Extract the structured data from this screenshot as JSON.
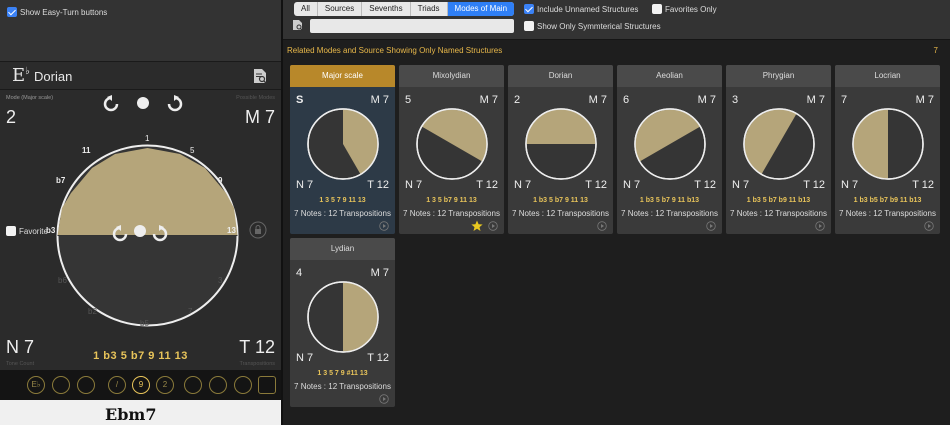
{
  "left": {
    "easy_turn_label": "Show Easy-Turn buttons",
    "key_letter": "E",
    "key_accidental": "♭",
    "mode_name": "Dorian",
    "mode_source_label": "Mode (Major scale)",
    "possible_modes_label": "Possible Modes",
    "mode_number": "2",
    "mode_count": "M 7",
    "favorite_label": "Favorite",
    "note_count": "N 7",
    "transpositions": "T 12",
    "tone_count_label": "Tone Count",
    "transpositions_label": "Transpositions",
    "formula": "1 b3 5 b7 9 11 13",
    "dial_labels": [
      "1",
      "5",
      "9",
      "13",
      "3",
      "7",
      "b5",
      "b2",
      "b6",
      "b3",
      "b7",
      "11"
    ],
    "toolbar_buttons": [
      "E♭",
      "",
      "",
      "",
      "/",
      "9",
      "2",
      "",
      "",
      "",
      ""
    ],
    "chord_name": "Ebm7",
    "accent_color": "#b5a57a"
  },
  "filter": {
    "tabs": [
      "All",
      "Sources",
      "Sevenths",
      "Triads",
      "Modes of Main"
    ],
    "active_tab": "Modes of Main",
    "include_unnamed_label": "Include Unnamed Structures",
    "favorites_only_label": "Favorites Only",
    "symmetrical_label": "Show Only Symmterical Structures",
    "search_value": ""
  },
  "related": {
    "title": "Related Modes and Source Showing Only Named Structures",
    "count": "7"
  },
  "cards": [
    {
      "name": "Major scale",
      "tl": "S",
      "tr": "M 7",
      "bl": "N 7",
      "br": "T 12",
      "formula": "1 3 5 7 9 11 13",
      "notes": "7 Notes : 12 Transpositions",
      "selected": true,
      "start": 0,
      "end": 150,
      "favorite": false
    },
    {
      "name": "Mixolydian",
      "tl": "5",
      "tr": "M 7",
      "bl": "N 7",
      "br": "T 12",
      "formula": "1 3 5 b7 9 11 13",
      "notes": "7 Notes : 12 Transpositions",
      "selected": false,
      "start": -60,
      "end": 120,
      "favorite": true
    },
    {
      "name": "Dorian",
      "tl": "2",
      "tr": "M 7",
      "bl": "N 7",
      "br": "T 12",
      "formula": "1 b3 5 b7 9 11 13",
      "notes": "7 Notes : 12 Transpositions",
      "selected": false,
      "start": -90,
      "end": 90,
      "favorite": false
    },
    {
      "name": "Aeolian",
      "tl": "6",
      "tr": "M 7",
      "bl": "N 7",
      "br": "T 12",
      "formula": "1 b3 5 b7 9 11 b13",
      "notes": "7 Notes : 12 Transpositions",
      "selected": false,
      "start": -120,
      "end": 60,
      "favorite": false
    },
    {
      "name": "Phrygian",
      "tl": "3",
      "tr": "M 7",
      "bl": "N 7",
      "br": "T 12",
      "formula": "1 b3 5 b7 b9 11 b13",
      "notes": "7 Notes : 12 Transpositions",
      "selected": false,
      "start": -150,
      "end": 30,
      "favorite": false
    },
    {
      "name": "Locrian",
      "tl": "7",
      "tr": "M 7",
      "bl": "N 7",
      "br": "T 12",
      "formula": "1 b3 b5 b7 b9 11 b13",
      "notes": "7 Notes : 12 Transpositions",
      "selected": false,
      "start": -180,
      "end": 0,
      "favorite": false
    },
    {
      "name": "Lydian",
      "tl": "4",
      "tr": "M 7",
      "bl": "N 7",
      "br": "T 12",
      "formula": "1 3 5 7 9 #11 13",
      "notes": "7 Notes : 12 Transpositions",
      "selected": false,
      "start": 0,
      "end": 180,
      "favorite": false
    }
  ]
}
